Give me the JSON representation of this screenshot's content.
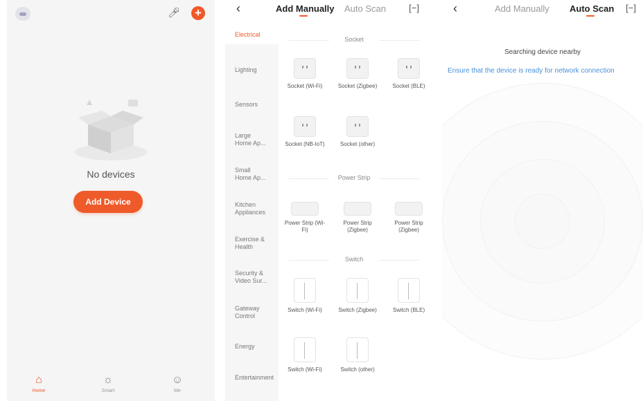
{
  "home": {
    "empty_text": "No devices",
    "add_device_label": "Add Device",
    "tabs": [
      {
        "label": "Home",
        "icon": "home-icon"
      },
      {
        "label": "Smart",
        "icon": "sun-icon"
      },
      {
        "label": "Me",
        "icon": "user-icon"
      }
    ]
  },
  "manual": {
    "tab_add": "Add Manually",
    "tab_scan": "Auto Scan",
    "categories": [
      "Electrical",
      "Lighting",
      "Sensors",
      "Large Home Ap...",
      "Small Home Ap...",
      "Kitchen Appliances",
      "Exercise & Health",
      "Security & Video Sur...",
      "Gateway Control",
      "Energy",
      "Entertainment"
    ],
    "sections": [
      {
        "title": "Socket",
        "devices": [
          "Socket (Wi-Fi)",
          "Socket (Zigbee)",
          "Socket (BLE)",
          "Socket (NB-IoT)",
          "Socket (other)"
        ]
      },
      {
        "title": "Power Strip",
        "devices": [
          "Power Strip (Wi-Fi)",
          "Power Strip (Zigbee)",
          "Power Strip (Zigbee)"
        ]
      },
      {
        "title": "Switch",
        "devices": [
          "Switch (Wi-Fi)",
          "Switch (Zigbee)",
          "Switch (BLE)",
          "Switch (Wi-Fi)",
          "Switch (other)"
        ]
      }
    ]
  },
  "scan": {
    "tab_add": "Add Manually",
    "tab_scan": "Auto Scan",
    "searching_text": "Searching device nearby",
    "ensure_text": "Ensure that the device is ready for network connection"
  },
  "colors": {
    "accent": "#ee5a2a",
    "link": "#4a90d9"
  }
}
